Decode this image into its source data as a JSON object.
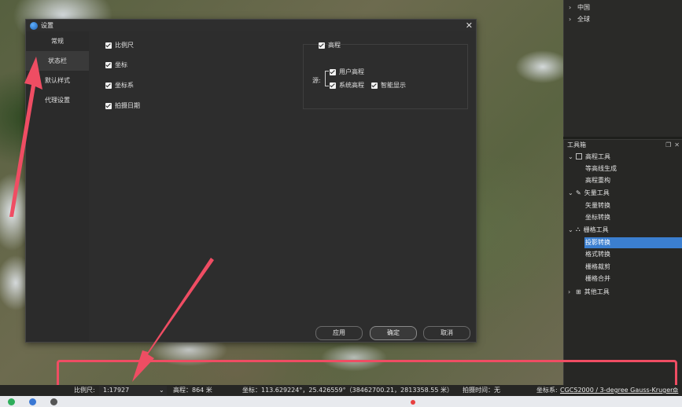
{
  "layer_tree": {
    "items": [
      {
        "label": "中国"
      },
      {
        "label": "全球"
      }
    ]
  },
  "toolbox": {
    "title": "工具箱",
    "groups": [
      {
        "label": "高程工具",
        "items": [
          "等高线生成",
          "高程重构"
        ]
      },
      {
        "label": "矢量工具",
        "items": [
          "矢量转换",
          "坐标转换"
        ]
      },
      {
        "label": "栅格工具",
        "items": [
          "投影转换",
          "格式转换",
          "栅格裁剪",
          "栅格合并"
        ]
      },
      {
        "label": "其他工具",
        "items": []
      }
    ],
    "selected_item": "投影转换"
  },
  "dialog": {
    "title": "设置",
    "nav": [
      "常规",
      "状态栏",
      "默认样式",
      "代理设置"
    ],
    "active_nav": "状态栏",
    "checkboxes": [
      "比例尺",
      "坐标",
      "坐标系",
      "拍摄日期"
    ],
    "elevation": {
      "label": "高程",
      "source_label": "源:",
      "options": [
        "用户高程",
        "系统高程",
        "智能显示"
      ]
    },
    "buttons": {
      "apply": "应用",
      "ok": "确定",
      "cancel": "取消"
    }
  },
  "statusbar": {
    "scale_label": "比例尺:",
    "scale_value": "1:17927",
    "elevation": "高程：864 米",
    "coordinates": "坐标：113.629224°，25.426559°（38462700.21，2813358.55 米）",
    "capture_time": "拍摄时间：无",
    "crs_label": "坐标系:",
    "crs_value": "CGCS2000 / 3-degree Gauss-Kruger..."
  },
  "colors": {
    "accent": "#3b7fd0",
    "annotation": "#ef4d63"
  }
}
